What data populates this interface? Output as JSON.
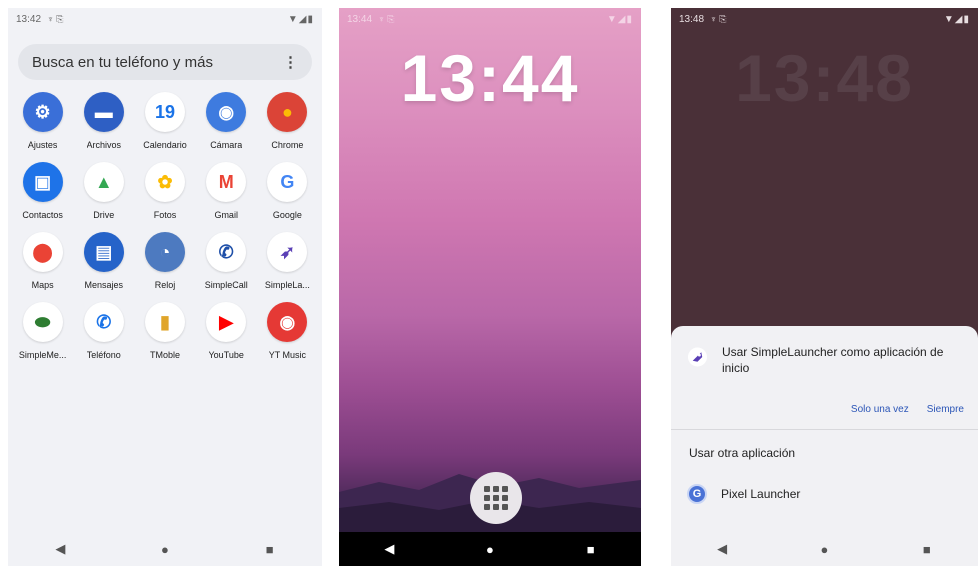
{
  "screen1": {
    "status": {
      "time": "13:42",
      "icons": "♆ ⎘",
      "signal": "▼◢▮"
    },
    "search": {
      "placeholder": "Busca en tu teléfono y más",
      "menu": "⋮"
    },
    "apps": [
      {
        "label": "Ajustes",
        "icon": "gear-icon",
        "glyph": "⚙",
        "color": "#3a6fd8"
      },
      {
        "label": "Archivos",
        "icon": "folder-icon",
        "glyph": "▬",
        "color": "#2e5fc4"
      },
      {
        "label": "Calendario",
        "icon": "calendar-icon",
        "glyph": "19",
        "color": "#ffffff"
      },
      {
        "label": "Cámara",
        "icon": "camera-icon",
        "glyph": "◉",
        "color": "#3e7bdf"
      },
      {
        "label": "Chrome",
        "icon": "chrome-icon",
        "glyph": "●",
        "color": "#db4437"
      },
      {
        "label": "Contactos",
        "icon": "contacts-icon",
        "glyph": "▣",
        "color": "#1e73e8"
      },
      {
        "label": "Drive",
        "icon": "drive-icon",
        "glyph": "▲",
        "color": "#ffffff"
      },
      {
        "label": "Fotos",
        "icon": "photos-icon",
        "glyph": "✿",
        "color": "#ffffff"
      },
      {
        "label": "Gmail",
        "icon": "gmail-icon",
        "glyph": "M",
        "color": "#ffffff"
      },
      {
        "label": "Google",
        "icon": "google-icon",
        "glyph": "G",
        "color": "#ffffff"
      },
      {
        "label": "Maps",
        "icon": "maps-icon",
        "glyph": "⬤",
        "color": "#ffffff"
      },
      {
        "label": "Mensajes",
        "icon": "messages-icon",
        "glyph": "▤",
        "color": "#2563c9"
      },
      {
        "label": "Reloj",
        "icon": "clock-icon",
        "glyph": "◔",
        "color": "#4d7ac0"
      },
      {
        "label": "SimpleCall",
        "icon": "simplecall-icon",
        "glyph": "✆",
        "color": "#ffffff"
      },
      {
        "label": "SimpleLa...",
        "icon": "rocket-icon",
        "glyph": "➶",
        "color": "#ffffff"
      },
      {
        "label": "SimpleMe...",
        "icon": "pill-icon",
        "glyph": "⬬",
        "color": "#ffffff"
      },
      {
        "label": "Teléfono",
        "icon": "phone-icon",
        "glyph": "✆",
        "color": "#ffffff"
      },
      {
        "label": "TMoble",
        "icon": "tmoble-icon",
        "glyph": "▮",
        "color": "#ffffff"
      },
      {
        "label": "YouTube",
        "icon": "youtube-icon",
        "glyph": "▶",
        "color": "#ffffff"
      },
      {
        "label": "YT Music",
        "icon": "ytmusic-icon",
        "glyph": "◉",
        "color": "#e53935"
      }
    ],
    "nav": {
      "back": "◀",
      "home": "●",
      "recents": "■"
    }
  },
  "screen2": {
    "status": {
      "time": "13:44",
      "icons": "♆ ⎘",
      "signal": "▼◢▮"
    },
    "clock": "13:44",
    "nav": {
      "back": "◀",
      "home": "●",
      "recents": "■"
    }
  },
  "screen3": {
    "status": {
      "time": "13:48",
      "icons": "♆ ⎘",
      "signal": "▼◢▮"
    },
    "clock": "13:48",
    "dialog": {
      "title": "Usar SimpleLauncher como aplicación de inicio",
      "once": "Solo una vez",
      "always": "Siempre",
      "other": "Usar otra aplicación",
      "pixel_label": "Pixel Launcher",
      "pixel_glyph": "G"
    },
    "nav": {
      "back": "◀",
      "home": "●",
      "recents": "■"
    }
  },
  "colors": {
    "accent_link": "#2c56b7",
    "lock_bg": "#4a3038"
  }
}
